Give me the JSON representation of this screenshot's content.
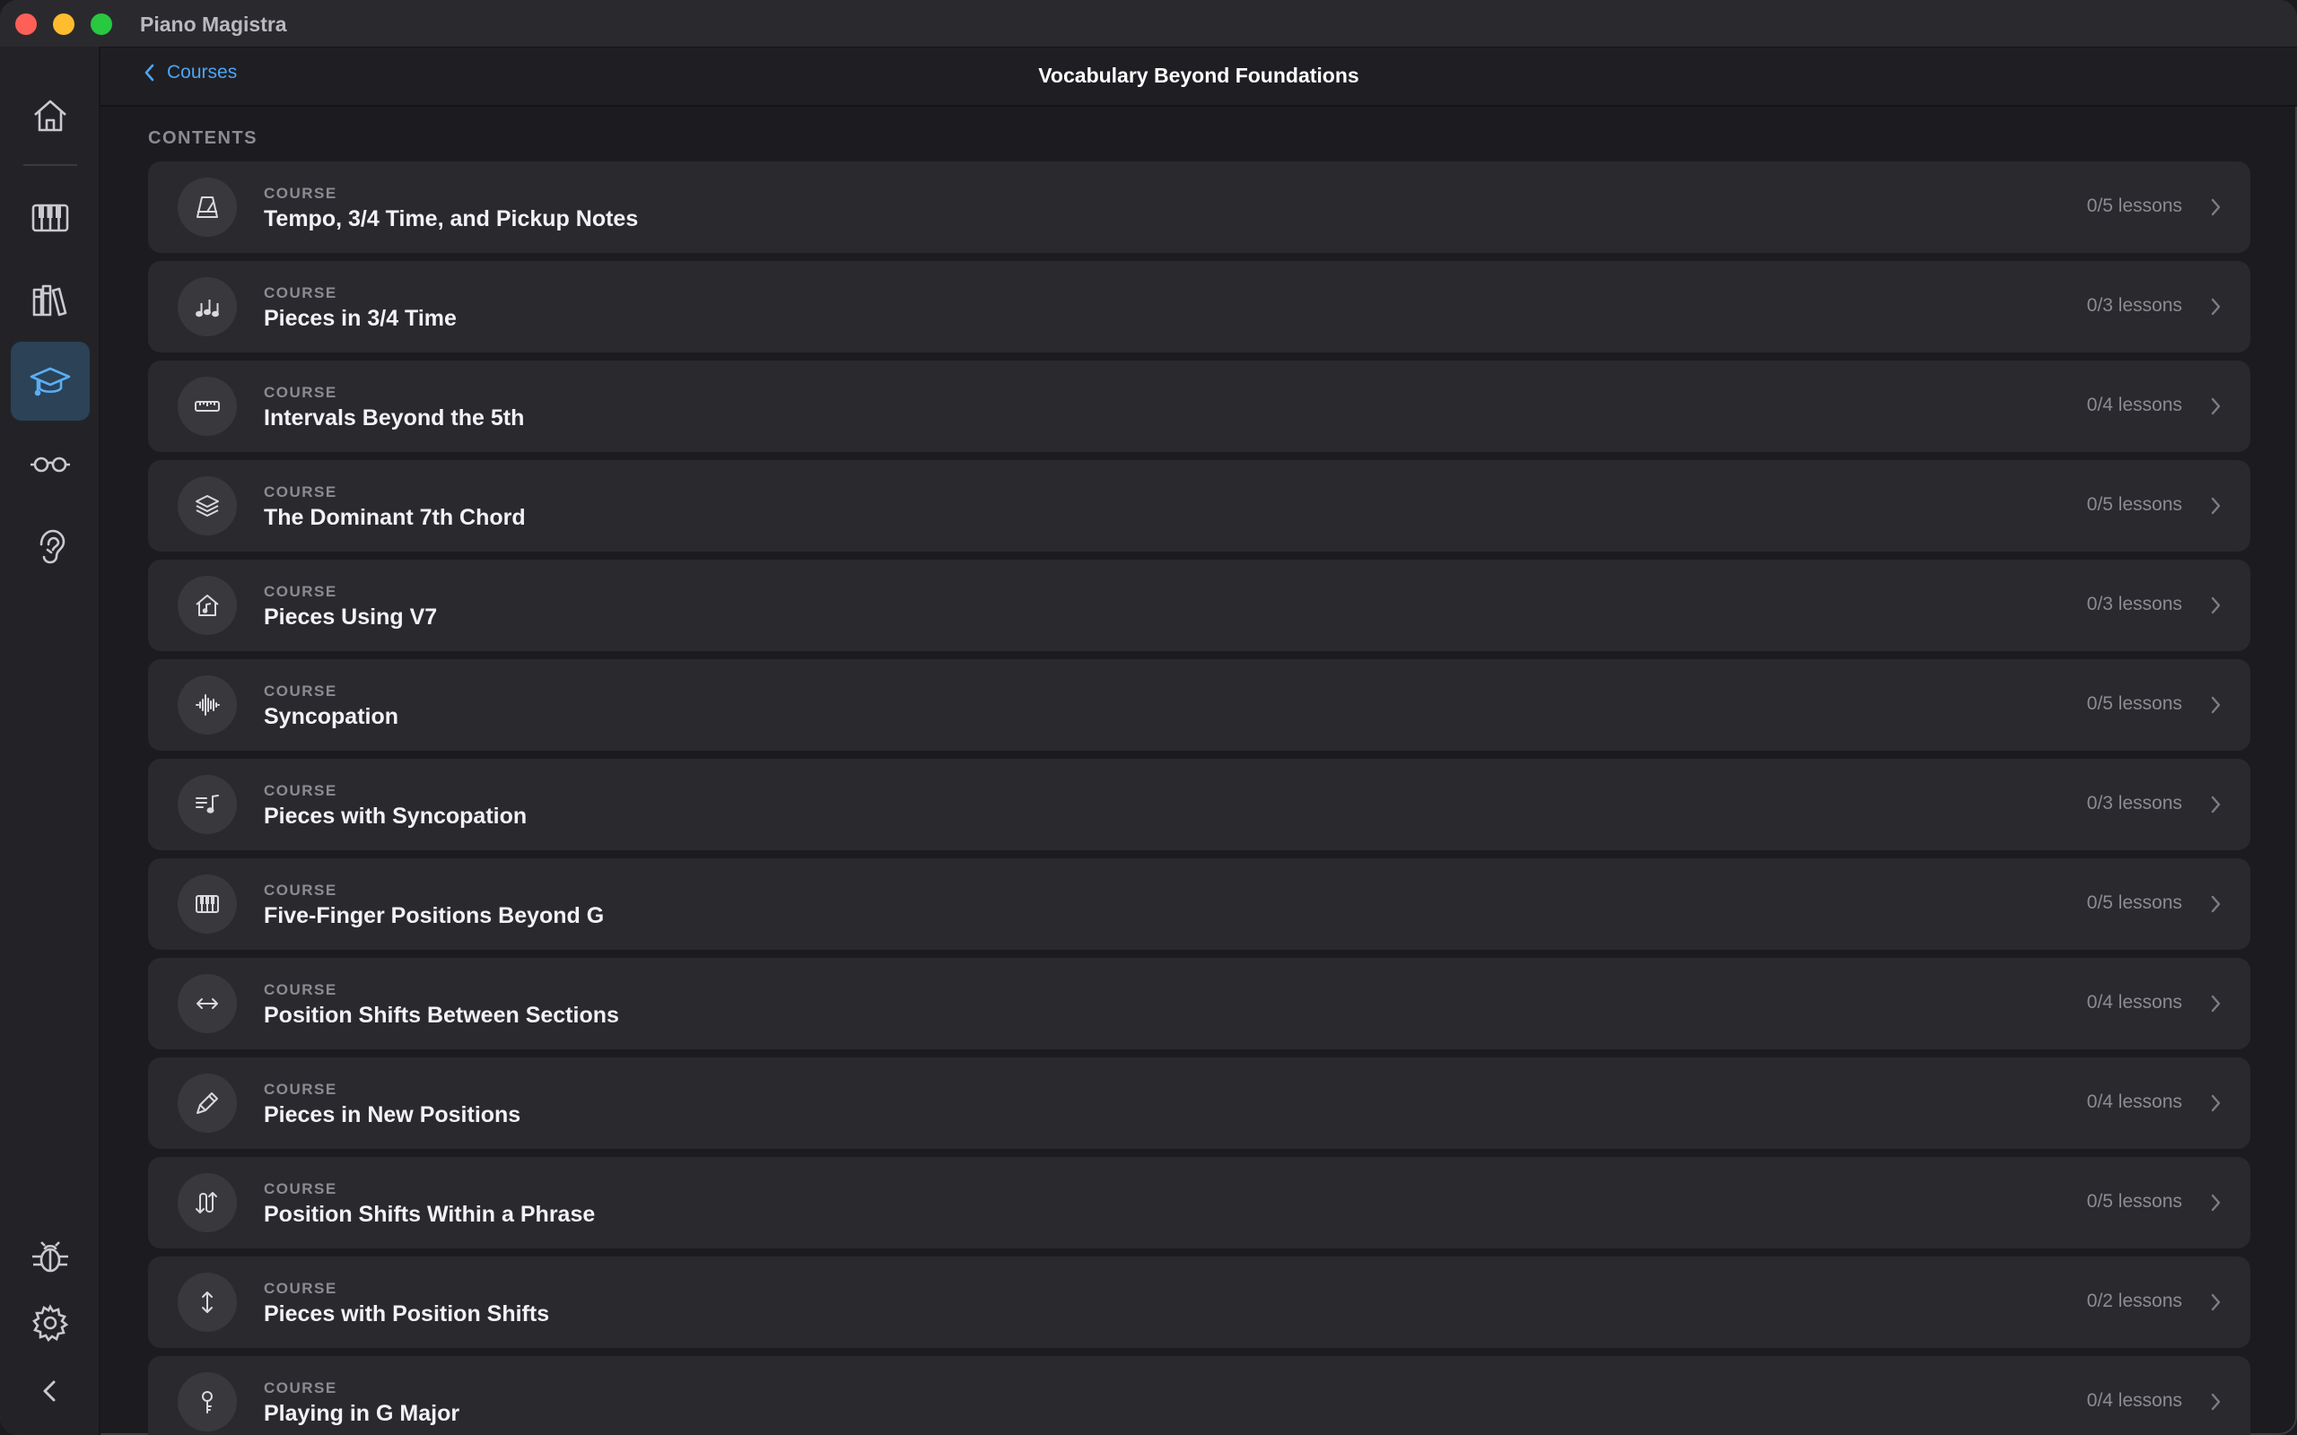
{
  "window": {
    "app_title": "Piano Magistra"
  },
  "header": {
    "back_label": "Courses",
    "title": "Vocabulary Beyond Foundations"
  },
  "section": {
    "label": "CONTENTS"
  },
  "sidebar": {
    "items": [
      {
        "id": "home",
        "icon": "home-icon",
        "active": false
      },
      {
        "id": "keyboard",
        "icon": "piano-keys-icon",
        "active": false
      },
      {
        "id": "library",
        "icon": "books-icon",
        "active": false
      },
      {
        "id": "courses",
        "icon": "graduation-cap-icon",
        "active": true
      },
      {
        "id": "reading",
        "icon": "glasses-icon",
        "active": false
      },
      {
        "id": "ear-training",
        "icon": "ear-icon",
        "active": false
      }
    ],
    "bottom": [
      {
        "id": "debug",
        "icon": "bug-icon"
      },
      {
        "id": "settings",
        "icon": "gear-icon"
      },
      {
        "id": "collapse",
        "icon": "chevron-left-icon"
      }
    ]
  },
  "courses": [
    {
      "kicker": "COURSE",
      "title": "Tempo, 3/4 Time, and Pickup Notes",
      "count": "0/5 lessons",
      "icon": "metronome-icon"
    },
    {
      "kicker": "COURSE",
      "title": "Pieces in 3/4 Time",
      "count": "0/3 lessons",
      "icon": "music-notes-icon"
    },
    {
      "kicker": "COURSE",
      "title": "Intervals Beyond the 5th",
      "count": "0/4 lessons",
      "icon": "ruler-icon"
    },
    {
      "kicker": "COURSE",
      "title": "The Dominant 7th Chord",
      "count": "0/5 lessons",
      "icon": "layers-icon"
    },
    {
      "kicker": "COURSE",
      "title": "Pieces Using V7",
      "count": "0/3 lessons",
      "icon": "house-music-icon"
    },
    {
      "kicker": "COURSE",
      "title": "Syncopation",
      "count": "0/5 lessons",
      "icon": "waveform-icon"
    },
    {
      "kicker": "COURSE",
      "title": "Pieces with Syncopation",
      "count": "0/3 lessons",
      "icon": "music-list-icon"
    },
    {
      "kicker": "COURSE",
      "title": "Five-Finger Positions Beyond G",
      "count": "0/5 lessons",
      "icon": "piano-keys-icon"
    },
    {
      "kicker": "COURSE",
      "title": "Position Shifts Between Sections",
      "count": "0/4 lessons",
      "icon": "arrow-left-right-icon"
    },
    {
      "kicker": "COURSE",
      "title": "Pieces in New Positions",
      "count": "0/4 lessons",
      "icon": "pen-icon"
    },
    {
      "kicker": "COURSE",
      "title": "Position Shifts Within a Phrase",
      "count": "0/5 lessons",
      "icon": "swap-arrows-icon"
    },
    {
      "kicker": "COURSE",
      "title": "Pieces with Position Shifts",
      "count": "0/2 lessons",
      "icon": "arrow-up-down-icon"
    },
    {
      "kicker": "COURSE",
      "title": "Playing in G Major",
      "count": "0/4 lessons",
      "icon": "key-icon"
    }
  ]
}
